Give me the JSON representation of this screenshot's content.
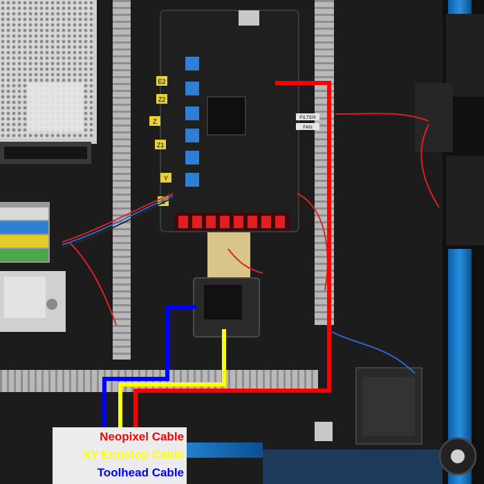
{
  "legend": {
    "neopixel": {
      "label": "Neopixel Cable",
      "color": "#ff0000"
    },
    "xy_endstop": {
      "label": "XY Endstop Cable",
      "color": "#ffff00"
    },
    "toolhead": {
      "label": "Toolhead Cable",
      "color": "#0000ff"
    }
  },
  "board": {
    "fan_labels": [
      "FAN",
      "FILTER"
    ]
  },
  "driver_labels": [
    "E2",
    "Z2",
    "Z",
    "Z1",
    "Y",
    "B"
  ]
}
